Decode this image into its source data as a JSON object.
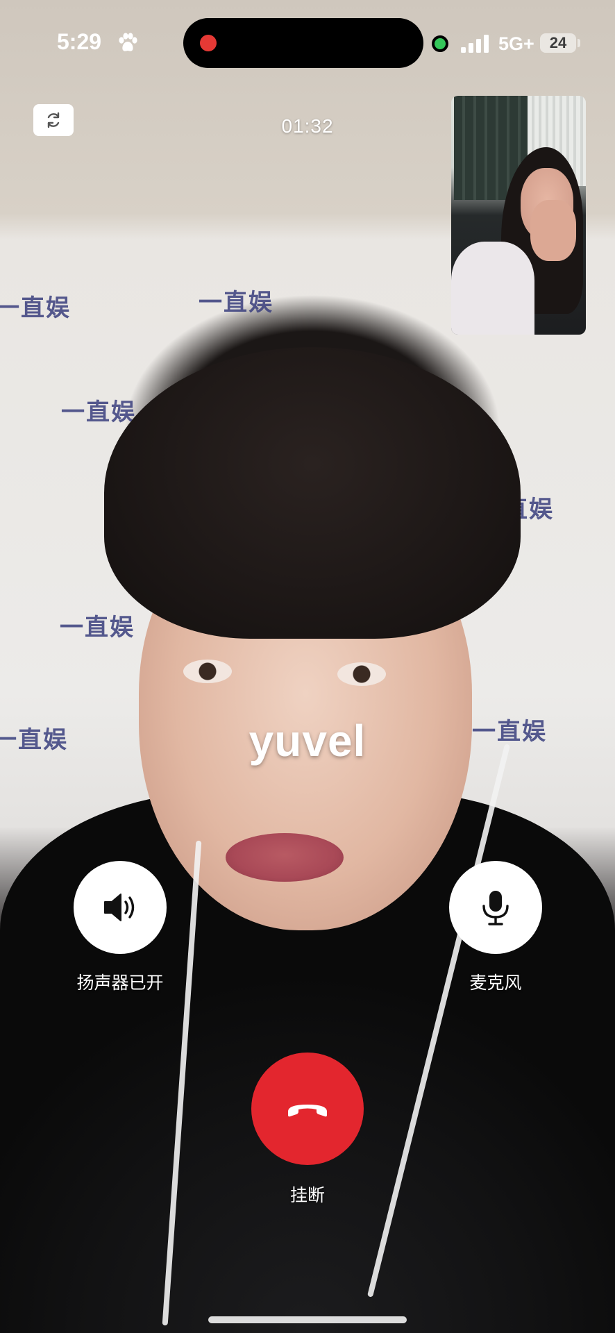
{
  "status_bar": {
    "time": "5:29",
    "network": "5G+",
    "battery": "24"
  },
  "call": {
    "duration": "01:32",
    "caller_name": "yuvel"
  },
  "background_banner": {
    "text": "一直娱"
  },
  "controls": {
    "speaker_label": "扬声器已开",
    "mic_label": "麦克风",
    "hangup_label": "挂断"
  },
  "colors": {
    "hangup": "#e3262e",
    "record_dot": "#e53935",
    "mic_indicator": "#34c759"
  }
}
